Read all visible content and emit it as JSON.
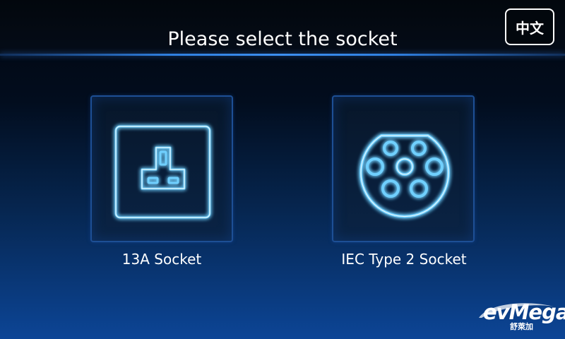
{
  "header": {
    "title": "Please select the socket",
    "language_button_label": "中文"
  },
  "sockets": [
    {
      "label": "13A Socket",
      "icon": "uk-13a-socket-icon"
    },
    {
      "label": "IEC Type 2 Socket",
      "icon": "type2-connector-icon"
    }
  ],
  "brand": {
    "logo_text": "evMega",
    "logo_subtext": "舒萊加"
  },
  "colors": {
    "accent": "#3d8ff0",
    "icon_glow": "#2fa6ff",
    "background_top": "#01060e",
    "background_bottom": "#0c4596"
  }
}
